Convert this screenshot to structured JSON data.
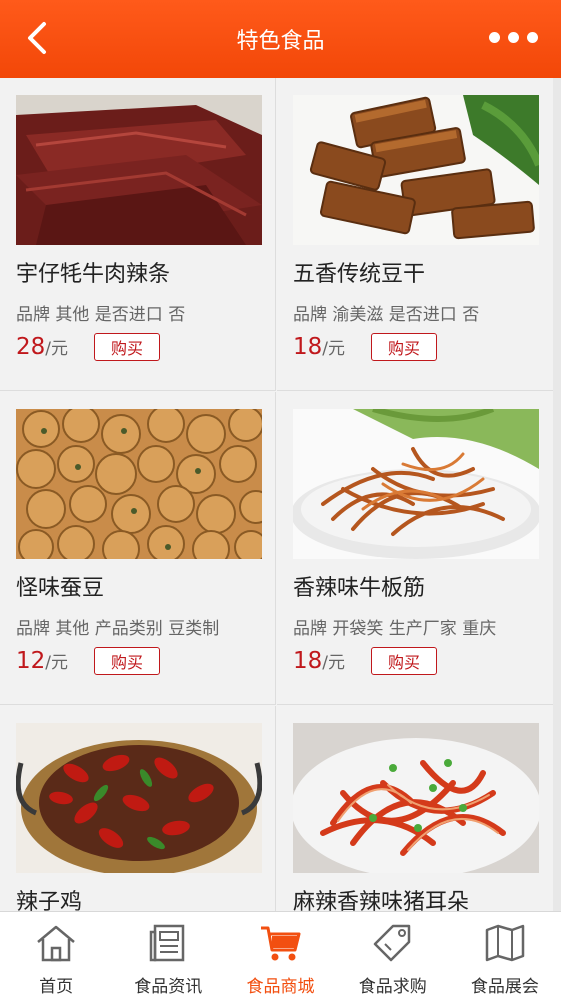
{
  "header": {
    "title": "特色食品"
  },
  "products": [
    {
      "name": "宇仔牦牛肉辣条",
      "attrs": "品牌 其他 是否进口 否",
      "price": "28",
      "unit": "/元",
      "buy": "购买"
    },
    {
      "name": "五香传统豆干",
      "attrs": "品牌 渝美滋 是否进口 否",
      "price": "18",
      "unit": "/元",
      "buy": "购买"
    },
    {
      "name": "怪味蚕豆",
      "attrs": "品牌 其他 产品类别 豆类制",
      "price": "12",
      "unit": "/元",
      "buy": "购买"
    },
    {
      "name": "香辣味牛板筋",
      "attrs": "品牌 开袋笑 生产厂家 重庆",
      "price": "18",
      "unit": "/元",
      "buy": "购买"
    },
    {
      "name": "辣子鸡",
      "attrs": "",
      "price": "",
      "unit": "",
      "buy": ""
    },
    {
      "name": "麻辣香辣味猪耳朵",
      "attrs": "",
      "price": "",
      "unit": "",
      "buy": ""
    }
  ],
  "tabs": [
    {
      "label": "首页",
      "icon": "home-icon",
      "active": false
    },
    {
      "label": "食品资讯",
      "icon": "news-icon",
      "active": false
    },
    {
      "label": "食品商城",
      "icon": "cart-icon",
      "active": true
    },
    {
      "label": "食品求购",
      "icon": "tag-icon",
      "active": false
    },
    {
      "label": "食品展会",
      "icon": "map-icon",
      "active": false
    }
  ],
  "colors": {
    "header": "#f24708",
    "accent": "#c0181c",
    "active_tab": "#f24f10"
  }
}
